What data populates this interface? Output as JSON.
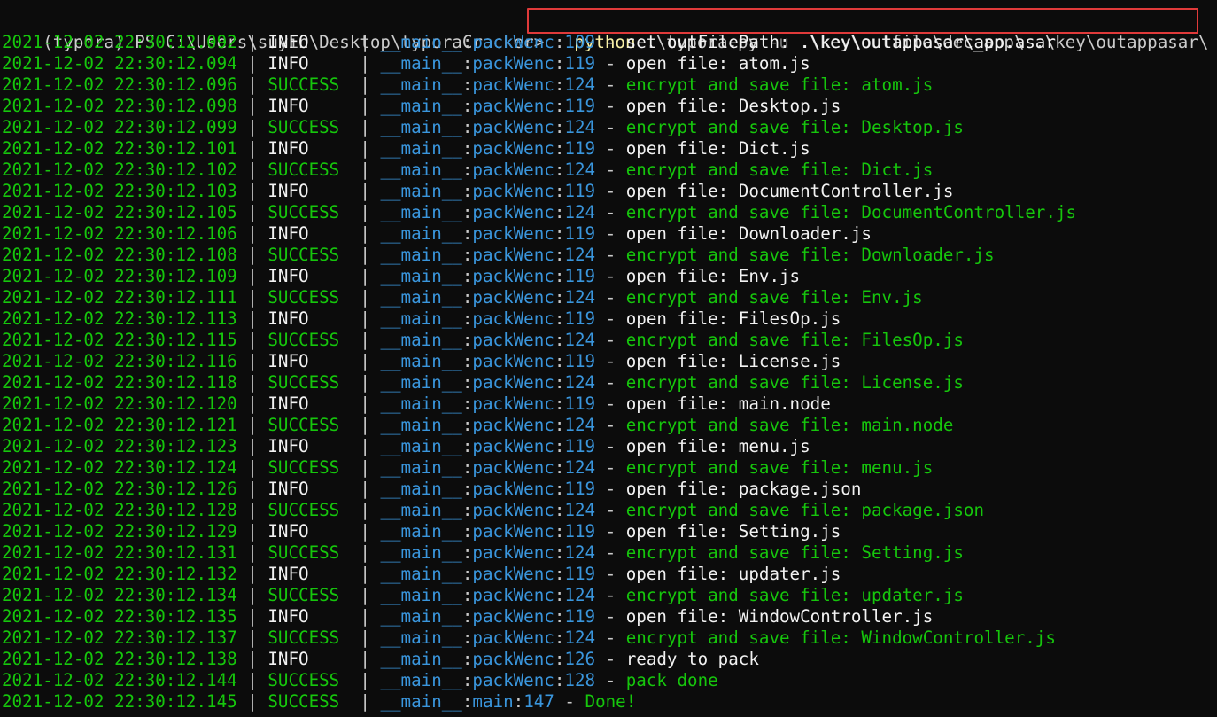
{
  "window": {
    "title": ""
  },
  "prompt": {
    "text": "(typora) PS C:\\Users\\suyin\\Desktop\\typoraCracker> ",
    "command_exe": "python",
    "command_script": " .\\typora.py ",
    "command_flag": "-u",
    "command_args": " .\\key\\outfile\\dec_app\\ .\\key\\outappasar\\"
  },
  "colors": {
    "timestamp": "#16c60c",
    "info_level": "#f2f2f2",
    "success_level": "#16c60c",
    "module": "#3a96dd",
    "highlight_box": "#e03a3a",
    "command": "#f9f1a5",
    "background": "#0c0c0c"
  },
  "log_lines": [
    {
      "ts": "2021-12-02 22:30:12.092",
      "level": "INFO",
      "module": "__main__",
      "func": "packWenc",
      "line": "109",
      "msg": "set outFilePath: .\\key\\outappasar\\app.asar"
    },
    {
      "ts": "2021-12-02 22:30:12.094",
      "level": "INFO",
      "module": "__main__",
      "func": "packWenc",
      "line": "119",
      "msg": "open file: atom.js"
    },
    {
      "ts": "2021-12-02 22:30:12.096",
      "level": "SUCCESS",
      "module": "__main__",
      "func": "packWenc",
      "line": "124",
      "msg": "encrypt and save file: atom.js"
    },
    {
      "ts": "2021-12-02 22:30:12.098",
      "level": "INFO",
      "module": "__main__",
      "func": "packWenc",
      "line": "119",
      "msg": "open file: Desktop.js"
    },
    {
      "ts": "2021-12-02 22:30:12.099",
      "level": "SUCCESS",
      "module": "__main__",
      "func": "packWenc",
      "line": "124",
      "msg": "encrypt and save file: Desktop.js"
    },
    {
      "ts": "2021-12-02 22:30:12.101",
      "level": "INFO",
      "module": "__main__",
      "func": "packWenc",
      "line": "119",
      "msg": "open file: Dict.js"
    },
    {
      "ts": "2021-12-02 22:30:12.102",
      "level": "SUCCESS",
      "module": "__main__",
      "func": "packWenc",
      "line": "124",
      "msg": "encrypt and save file: Dict.js"
    },
    {
      "ts": "2021-12-02 22:30:12.103",
      "level": "INFO",
      "module": "__main__",
      "func": "packWenc",
      "line": "119",
      "msg": "open file: DocumentController.js"
    },
    {
      "ts": "2021-12-02 22:30:12.105",
      "level": "SUCCESS",
      "module": "__main__",
      "func": "packWenc",
      "line": "124",
      "msg": "encrypt and save file: DocumentController.js"
    },
    {
      "ts": "2021-12-02 22:30:12.106",
      "level": "INFO",
      "module": "__main__",
      "func": "packWenc",
      "line": "119",
      "msg": "open file: Downloader.js"
    },
    {
      "ts": "2021-12-02 22:30:12.108",
      "level": "SUCCESS",
      "module": "__main__",
      "func": "packWenc",
      "line": "124",
      "msg": "encrypt and save file: Downloader.js"
    },
    {
      "ts": "2021-12-02 22:30:12.109",
      "level": "INFO",
      "module": "__main__",
      "func": "packWenc",
      "line": "119",
      "msg": "open file: Env.js"
    },
    {
      "ts": "2021-12-02 22:30:12.111",
      "level": "SUCCESS",
      "module": "__main__",
      "func": "packWenc",
      "line": "124",
      "msg": "encrypt and save file: Env.js"
    },
    {
      "ts": "2021-12-02 22:30:12.113",
      "level": "INFO",
      "module": "__main__",
      "func": "packWenc",
      "line": "119",
      "msg": "open file: FilesOp.js"
    },
    {
      "ts": "2021-12-02 22:30:12.115",
      "level": "SUCCESS",
      "module": "__main__",
      "func": "packWenc",
      "line": "124",
      "msg": "encrypt and save file: FilesOp.js"
    },
    {
      "ts": "2021-12-02 22:30:12.116",
      "level": "INFO",
      "module": "__main__",
      "func": "packWenc",
      "line": "119",
      "msg": "open file: License.js"
    },
    {
      "ts": "2021-12-02 22:30:12.118",
      "level": "SUCCESS",
      "module": "__main__",
      "func": "packWenc",
      "line": "124",
      "msg": "encrypt and save file: License.js"
    },
    {
      "ts": "2021-12-02 22:30:12.120",
      "level": "INFO",
      "module": "__main__",
      "func": "packWenc",
      "line": "119",
      "msg": "open file: main.node"
    },
    {
      "ts": "2021-12-02 22:30:12.121",
      "level": "SUCCESS",
      "module": "__main__",
      "func": "packWenc",
      "line": "124",
      "msg": "encrypt and save file: main.node"
    },
    {
      "ts": "2021-12-02 22:30:12.123",
      "level": "INFO",
      "module": "__main__",
      "func": "packWenc",
      "line": "119",
      "msg": "open file: menu.js"
    },
    {
      "ts": "2021-12-02 22:30:12.124",
      "level": "SUCCESS",
      "module": "__main__",
      "func": "packWenc",
      "line": "124",
      "msg": "encrypt and save file: menu.js"
    },
    {
      "ts": "2021-12-02 22:30:12.126",
      "level": "INFO",
      "module": "__main__",
      "func": "packWenc",
      "line": "119",
      "msg": "open file: package.json"
    },
    {
      "ts": "2021-12-02 22:30:12.128",
      "level": "SUCCESS",
      "module": "__main__",
      "func": "packWenc",
      "line": "124",
      "msg": "encrypt and save file: package.json"
    },
    {
      "ts": "2021-12-02 22:30:12.129",
      "level": "INFO",
      "module": "__main__",
      "func": "packWenc",
      "line": "119",
      "msg": "open file: Setting.js"
    },
    {
      "ts": "2021-12-02 22:30:12.131",
      "level": "SUCCESS",
      "module": "__main__",
      "func": "packWenc",
      "line": "124",
      "msg": "encrypt and save file: Setting.js"
    },
    {
      "ts": "2021-12-02 22:30:12.132",
      "level": "INFO",
      "module": "__main__",
      "func": "packWenc",
      "line": "119",
      "msg": "open file: updater.js"
    },
    {
      "ts": "2021-12-02 22:30:12.134",
      "level": "SUCCESS",
      "module": "__main__",
      "func": "packWenc",
      "line": "124",
      "msg": "encrypt and save file: updater.js"
    },
    {
      "ts": "2021-12-02 22:30:12.135",
      "level": "INFO",
      "module": "__main__",
      "func": "packWenc",
      "line": "119",
      "msg": "open file: WindowController.js"
    },
    {
      "ts": "2021-12-02 22:30:12.137",
      "level": "SUCCESS",
      "module": "__main__",
      "func": "packWenc",
      "line": "124",
      "msg": "encrypt and save file: WindowController.js"
    },
    {
      "ts": "2021-12-02 22:30:12.138",
      "level": "INFO",
      "module": "__main__",
      "func": "packWenc",
      "line": "126",
      "msg": "ready to pack"
    },
    {
      "ts": "2021-12-02 22:30:12.144",
      "level": "SUCCESS",
      "module": "__main__",
      "func": "packWenc",
      "line": "128",
      "msg": "pack done"
    },
    {
      "ts": "2021-12-02 22:30:12.145",
      "level": "SUCCESS",
      "module": "__main__",
      "func": "main",
      "line": "147",
      "msg": "Done!"
    }
  ]
}
